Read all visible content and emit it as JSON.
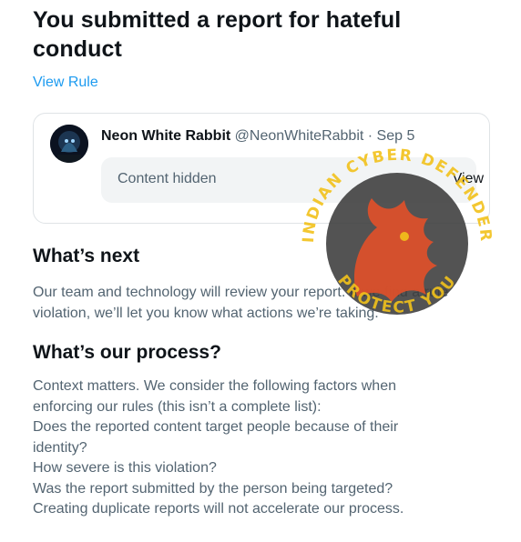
{
  "report": {
    "title_line1": "You submitted a report for hateful",
    "title_line2": "conduct",
    "view_rule": "View Rule"
  },
  "tweet": {
    "author_name": "Neon White Rabbit",
    "handle_date": "@NeonWhiteRabbit · Sep 5",
    "hidden_label": "Content hidden",
    "view_label": "View"
  },
  "whats_next": {
    "heading": "What’s next",
    "lines": [
      "Our team and technology will review your report. If we find a rule",
      "violation, we’ll let you know what actions we’re taking."
    ]
  },
  "process": {
    "heading": "What’s our process?",
    "lines": [
      "Context matters. We consider the following factors when",
      "enforcing our rules (this isn’t a complete list):",
      "Does the reported content target people because of their",
      "identity?",
      "How severe is this violation?",
      "Was the report submitted by the person being targeted?",
      "Creating duplicate reports will not accelerate our process."
    ]
  },
  "watermark": {
    "top_text": "INDIAN CYBER DEFENDER",
    "bottom_text": "PROTECT YOU",
    "colors": {
      "ring": "#f2c21b",
      "dragon": "#e0502a",
      "inner": "#404040"
    }
  }
}
